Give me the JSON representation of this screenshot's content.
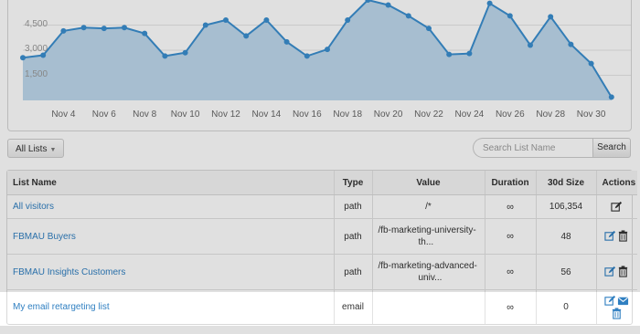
{
  "chart_data": {
    "type": "area",
    "y_ticks": [
      "1,500",
      "3,000",
      "4,500"
    ],
    "x_ticks": [
      "Nov 4",
      "Nov 6",
      "Nov 8",
      "Nov 10",
      "Nov 12",
      "Nov 14",
      "Nov 16",
      "Nov 18",
      "Nov 20",
      "Nov 22",
      "Nov 24",
      "Nov 26",
      "Nov 28",
      "Nov 30"
    ],
    "x": [
      2,
      3,
      4,
      5,
      6,
      7,
      8,
      9,
      10,
      11,
      12,
      13,
      14,
      15,
      16,
      17,
      18,
      19,
      20,
      21,
      22,
      23,
      24,
      25,
      26,
      27,
      28,
      29,
      30,
      31
    ],
    "values": [
      2550,
      2700,
      4150,
      4350,
      4300,
      4350,
      4000,
      2650,
      2850,
      4500,
      4800,
      3850,
      4800,
      3500,
      2650,
      3050,
      4800,
      6000,
      5700,
      5050,
      4300,
      2750,
      2800,
      5800,
      5050,
      3300,
      5000,
      3350,
      2200,
      200
    ],
    "ylim": [
      0,
      6000
    ],
    "line_color": "#3b8fd0",
    "fill_color": "#bfd9ed"
  },
  "toolbar": {
    "filter_label": "All Lists",
    "search_placeholder": "Search List Name",
    "search_button": "Search"
  },
  "table": {
    "headers": [
      "List Name",
      "Type",
      "Value",
      "Duration",
      "30d Size",
      "Actions"
    ],
    "rows": [
      {
        "name": "All visitors",
        "type": "path",
        "value": "/*",
        "duration": "∞",
        "size": "106,354"
      },
      {
        "name": "FBMAU Buyers",
        "type": "path",
        "value_line1": "/fb-marketing-university-",
        "value_line2": "th...",
        "duration": "∞",
        "size": "48"
      },
      {
        "name": "FBMAU Insights Customers",
        "type": "path",
        "value_line1": "/fb-marketing-advanced-",
        "value_line2": "univ...",
        "duration": "∞",
        "size": "56"
      },
      {
        "name": "My email retargeting list",
        "type": "email",
        "value": "",
        "duration": "∞",
        "size": "0"
      }
    ]
  },
  "icons": {
    "edit": "edit-icon",
    "delete": "trash-icon",
    "email": "envelope-icon"
  },
  "colors": {
    "link": "#2f7fc1",
    "icon": "#2f7fc1"
  }
}
